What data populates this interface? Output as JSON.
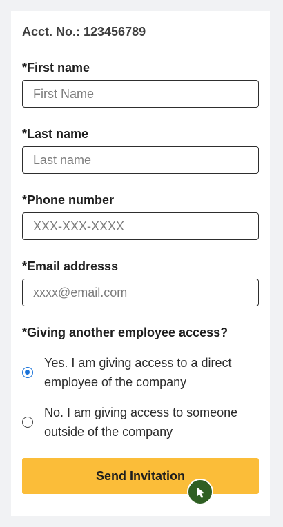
{
  "account": {
    "label": "Acct. No.: 123456789"
  },
  "form": {
    "first_name": {
      "label": "*First name",
      "placeholder": "First Name",
      "value": ""
    },
    "last_name": {
      "label": "*Last name",
      "placeholder": "Last name",
      "value": ""
    },
    "phone": {
      "label": "*Phone number",
      "placeholder": "XXX-XXX-XXXX",
      "value": ""
    },
    "email": {
      "label": "*Email addresss",
      "placeholder": "xxxx@email.com",
      "value": ""
    },
    "access_question": {
      "label": "*Giving another employee access?",
      "options": [
        {
          "label": "Yes. I am giving access to a direct employee of the company",
          "selected": true
        },
        {
          "label": "No. I am giving access to someone outside of the company",
          "selected": false
        }
      ]
    },
    "submit_label": "Send Invitation"
  },
  "colors": {
    "button": "#fbbd39",
    "radio_selected": "#1a73d9",
    "cursor_badge": "#2f5f23"
  },
  "icons": {
    "cursor": "mouse-pointer-icon"
  }
}
